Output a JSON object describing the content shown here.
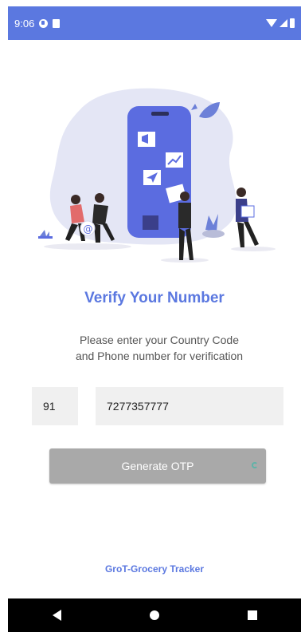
{
  "status_bar": {
    "time": "9:06",
    "left_icons": [
      "data-saver-icon",
      "sd-card-icon"
    ],
    "right_icons": [
      "wifi-icon",
      "signal-icon",
      "battery-icon"
    ]
  },
  "illustration": {
    "icon": "phone-verification-illustration",
    "at_symbol": "@"
  },
  "title": "Verify Your Number",
  "subtitle_line1": "Please enter your Country Code",
  "subtitle_line2": "and Phone number for verification",
  "country_code": {
    "value": "91"
  },
  "phone_number": {
    "value": "7277357777"
  },
  "generate_button": {
    "label": "Generate OTP"
  },
  "footer": "GroT-Grocery Tracker",
  "nav": {
    "icons": [
      "back-icon",
      "home-icon",
      "recents-icon"
    ]
  },
  "colors": {
    "accent": "#5b78e0",
    "button_disabled": "#a9a9a9",
    "field_bg": "#f0f0f0"
  }
}
